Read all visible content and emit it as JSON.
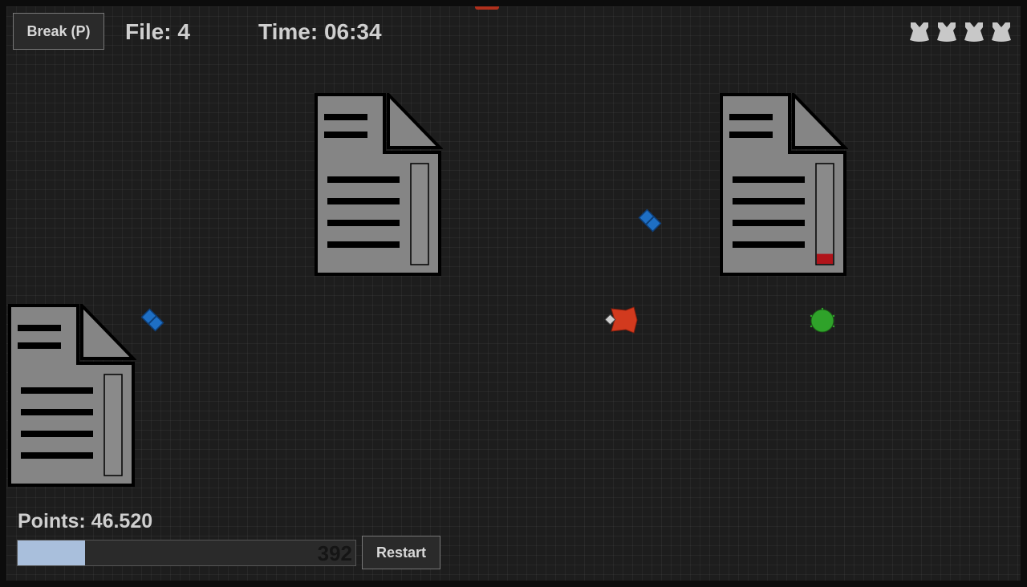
{
  "hud": {
    "break_label": "Break (P)",
    "file_label": "File: 4",
    "time_label": "Time: 06:34",
    "points_label": "Points: 46.520",
    "restart_label": "Restart",
    "progress_value_label": "392",
    "progress_fraction": 0.2
  },
  "lives": [
    {
      "icon": "shirt-icon"
    },
    {
      "icon": "shirt-icon"
    },
    {
      "icon": "shirt-icon"
    },
    {
      "icon": "shirt-icon"
    }
  ],
  "documents": [
    {
      "name": "document-1",
      "meter_fill": 0
    },
    {
      "name": "document-2",
      "meter_fill": 0.1
    },
    {
      "name": "document-3",
      "meter_fill": 0
    }
  ],
  "colors": {
    "player": "#d23a1e",
    "enemy_blue": "#1e6fc4",
    "enemy_green": "#2fa22a",
    "meter_red": "#b0141a",
    "progress_fill": "#a9bfdc"
  }
}
